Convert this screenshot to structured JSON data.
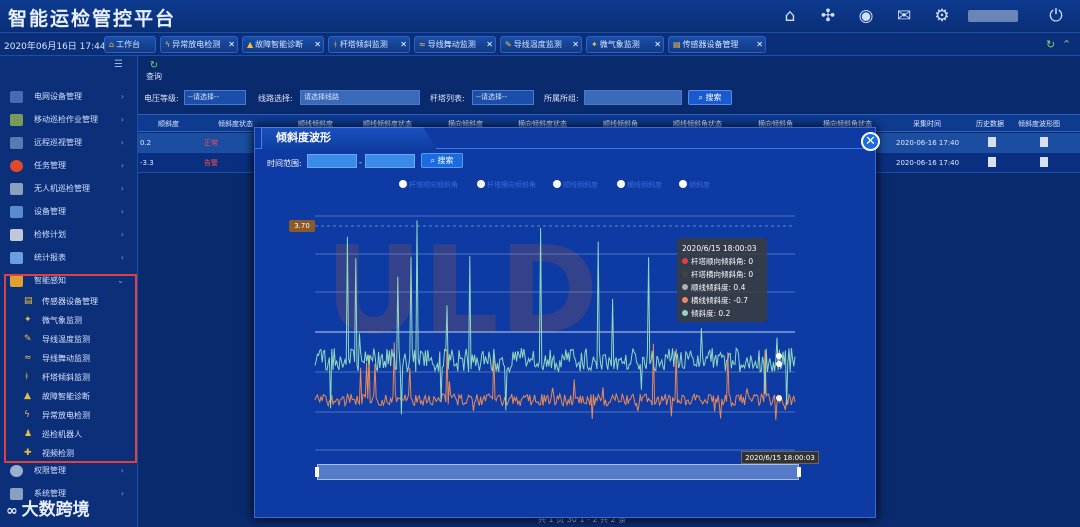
{
  "header": {
    "title": "智能运检管控平台",
    "icons": [
      "home-icon",
      "network-icon",
      "globe-icon",
      "mail-icon",
      "settings-icon",
      "power-icon"
    ]
  },
  "tabbar": {
    "datetime": "2020年06月16日 17:44:58",
    "tabs": [
      {
        "label": "工作台",
        "icon": "home-icon"
      },
      {
        "label": "异常放电检测",
        "icon": "lightning-icon"
      },
      {
        "label": "故障智能诊断",
        "icon": "warning-icon"
      },
      {
        "label": "杆塔倾斜监测",
        "icon": "tower-icon"
      },
      {
        "label": "导线舞动监测",
        "icon": "wave-icon"
      },
      {
        "label": "导线温度监测",
        "icon": "thermometer-icon"
      },
      {
        "label": "微气象监测",
        "icon": "weather-icon"
      },
      {
        "label": "传感器设备管理",
        "icon": "sensor-icon"
      }
    ]
  },
  "sidebar": {
    "menus": [
      "电网设备管理",
      "移动巡检作业管理",
      "远程巡视管理",
      "任务管理",
      "无人机巡检管理",
      "设备管理",
      "检修计划",
      "统计报表",
      "智能感知",
      "权限管理",
      "系统管理"
    ],
    "submenus": [
      "传感器设备管理",
      "微气象监测",
      "导线温度监测",
      "导线舞动监测",
      "杆塔倾斜监测",
      "故障智能诊断",
      "异常放电检测",
      "巡检机器人",
      "视频检测"
    ]
  },
  "toolbar": {
    "query_label": "查询"
  },
  "filters": {
    "voltage_label": "电压等级:",
    "voltage_value": "--请选择--",
    "line_label": "线路选择:",
    "line_placeholder": "请选择线路",
    "tower_label": "杆塔列表:",
    "tower_value": "--请选择--",
    "location_label": "所属所组:",
    "search_label": "搜索"
  },
  "table": {
    "headers": [
      "顺斜度",
      "倾斜度状态",
      "顺线倾斜度",
      "顺线倾斜度状态",
      "横向倾斜度",
      "横向倾斜度状态",
      "顺线倾斜角",
      "顺线倾斜角状态",
      "横向倾斜角",
      "横向倾斜角状态",
      "采集时间",
      "历史数据",
      "倾斜度波形图"
    ],
    "rows": [
      {
        "v1": "0.2",
        "status1": "正常",
        "status2": "正常",
        "time": "2020-06-16 17:40"
      },
      {
        "v1": "-3.3",
        "status1": "告警",
        "status2": "告警",
        "time": "2020-06-16 17:40"
      }
    ]
  },
  "pager": {
    "text": "共 1 页   30   1 - 2  共 2 条"
  },
  "watermark": {
    "text": "大数跨境"
  },
  "modal": {
    "title": "倾斜度波形",
    "time_range_label": "时间范围:",
    "separator": "-",
    "search_label": "搜索",
    "legend": [
      "杆塔顺向倾斜角",
      "杆塔横向倾斜角",
      "顺线倾斜度",
      "横线倾斜度",
      "倾斜度"
    ],
    "y_tag": "3.70",
    "x_tag": "2020/6/15 18:00:03",
    "tooltip": {
      "time": "2020/6/15 18:00:03",
      "items": [
        {
          "label": "杆塔顺向倾斜角: 0",
          "color": "#e04040"
        },
        {
          "label": "杆塔横向倾斜角: 0",
          "color": "#444444"
        },
        {
          "label": "顺线倾斜度: 0.4",
          "color": "#b0b0b0"
        },
        {
          "label": "横线倾斜度: -0.7",
          "color": "#e88a6a"
        },
        {
          "label": "倾斜度: 0.2",
          "color": "#9ad0c0"
        }
      ]
    },
    "colors": {
      "series_green": "#8fd8c0",
      "series_orange": "#e88a5a"
    }
  }
}
